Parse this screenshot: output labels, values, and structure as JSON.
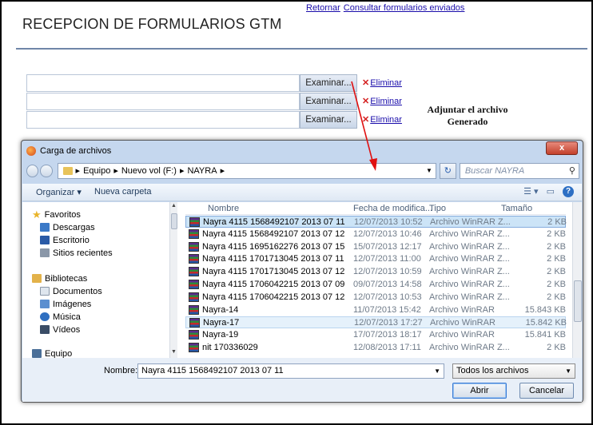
{
  "toplinks": {
    "back": "Retornar",
    "sent": "Consultar formularios enviados"
  },
  "page": {
    "title": "RECEPCION DE FORMULARIOS GTM"
  },
  "uploads": [
    {
      "browse": "Examinar...",
      "delete": "Eliminar"
    },
    {
      "browse": "Examinar...",
      "delete": "Eliminar"
    },
    {
      "browse": "Examinar...",
      "delete": "Eliminar"
    }
  ],
  "annotation": {
    "line1": "Adjuntar el archivo",
    "line2": "Generado"
  },
  "dialog": {
    "title": "Carga de archivos",
    "close": "x",
    "breadcrumb": [
      "Equipo",
      "Nuevo vol (F:)",
      "NAYRA"
    ],
    "search_placeholder": "Buscar NAYRA",
    "toolbar": {
      "organize": "Organizar ▾",
      "new_folder": "Nueva carpeta"
    },
    "sidebar": {
      "favorites": "Favoritos",
      "downloads": "Descargas",
      "desktop": "Escritorio",
      "recent": "Sitios recientes",
      "libraries": "Bibliotecas",
      "documents": "Documentos",
      "images": "Imágenes",
      "music": "Música",
      "videos": "Vídeos",
      "computer": "Equipo"
    },
    "columns": {
      "name": "Nombre",
      "date": "Fecha de modifica...",
      "type": "Tipo",
      "size": "Tamaño"
    },
    "files": [
      {
        "name": "Nayra 4115 1568492107 2013 07 11",
        "date": "12/07/2013 10:52",
        "type": "Archivo WinRAR Z...",
        "size": "2 KB"
      },
      {
        "name": "Nayra 4115 1568492107 2013 07 12",
        "date": "12/07/2013 10:46",
        "type": "Archivo WinRAR Z...",
        "size": "2 KB"
      },
      {
        "name": "Nayra 4115 1695162276 2013 07 15",
        "date": "15/07/2013 12:17",
        "type": "Archivo WinRAR Z...",
        "size": "2 KB"
      },
      {
        "name": "Nayra 4115 1701713045 2013 07 11",
        "date": "12/07/2013 11:00",
        "type": "Archivo WinRAR Z...",
        "size": "2 KB"
      },
      {
        "name": "Nayra 4115 1701713045 2013 07 12",
        "date": "12/07/2013 10:59",
        "type": "Archivo WinRAR Z...",
        "size": "2 KB"
      },
      {
        "name": "Nayra 4115 1706042215 2013 07 09",
        "date": "09/07/2013 14:58",
        "type": "Archivo WinRAR Z...",
        "size": "2 KB"
      },
      {
        "name": "Nayra 4115 1706042215 2013 07 12",
        "date": "12/07/2013 10:53",
        "type": "Archivo WinRAR Z...",
        "size": "2 KB"
      },
      {
        "name": "Nayra-14",
        "date": "11/07/2013 15:42",
        "type": "Archivo WinRAR",
        "size": "15.843 KB"
      },
      {
        "name": "Nayra-17",
        "date": "12/07/2013 17:27",
        "type": "Archivo WinRAR",
        "size": "15.842 KB"
      },
      {
        "name": "Nayra-19",
        "date": "17/07/2013 18:17",
        "type": "Archivo WinRAR",
        "size": "15.841 KB"
      },
      {
        "name": "nit 170336029",
        "date": "12/08/2013 17:11",
        "type": "Archivo WinRAR Z...",
        "size": "2 KB"
      }
    ],
    "filename_label": "Nombre:",
    "filename_value": "Nayra 4115 1568492107 2013 07 11",
    "filter": "Todos los archivos",
    "open": "Abrir",
    "cancel": "Cancelar"
  }
}
